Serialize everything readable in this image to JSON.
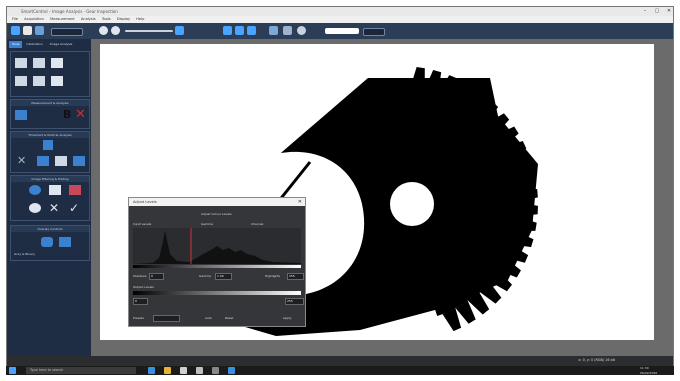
{
  "window": {
    "title": "SmartControl – Image Analysis · Gear Inspection"
  },
  "menu": [
    "File",
    "Acquisition",
    "Measurement",
    "Analysis",
    "Tools",
    "Display",
    "Help"
  ],
  "toolbar": {
    "zoom_value": "100%",
    "level_value": "0"
  },
  "sidebar": {
    "tabs": [
      "Tools",
      "Calibration",
      "Image Analysis"
    ],
    "groups": [
      {
        "title": "Measurement & Analysis"
      },
      {
        "title": "Threshold & Particle Analysis"
      },
      {
        "title": "Image Filtering & Editing"
      },
      {
        "title": "Overlay Controls"
      }
    ],
    "footer_text": "Grey & Binary"
  },
  "dialog": {
    "title": "Adjust Levels",
    "subtitle": "Adjust Colour Levels",
    "hist_label": "Input Levels",
    "mid_label": "Gamma",
    "right_label": "Channel",
    "shadows_label": "Shadows",
    "shadows_value": "0",
    "gamma_label": "Gamma",
    "gamma_value": "1.00",
    "highlights_label": "Highlights",
    "highlights_value": "255",
    "output_label": "Output Levels",
    "out_min": "0",
    "out_max": "255",
    "preset_label": "Presets",
    "auto_label": "Auto",
    "reset_label": "Reset",
    "apply_label": "Apply"
  },
  "status": {
    "left": "",
    "right": "x: 0, y: 0 (RGB) 16 bit"
  },
  "taskbar": {
    "search_placeholder": "Type here to search",
    "time": "11:30",
    "date": "06/02/2020"
  },
  "colors": {
    "accent": "#3a82cf",
    "toolbar": "#2b3d57",
    "sidebar": "#1f2d44"
  }
}
